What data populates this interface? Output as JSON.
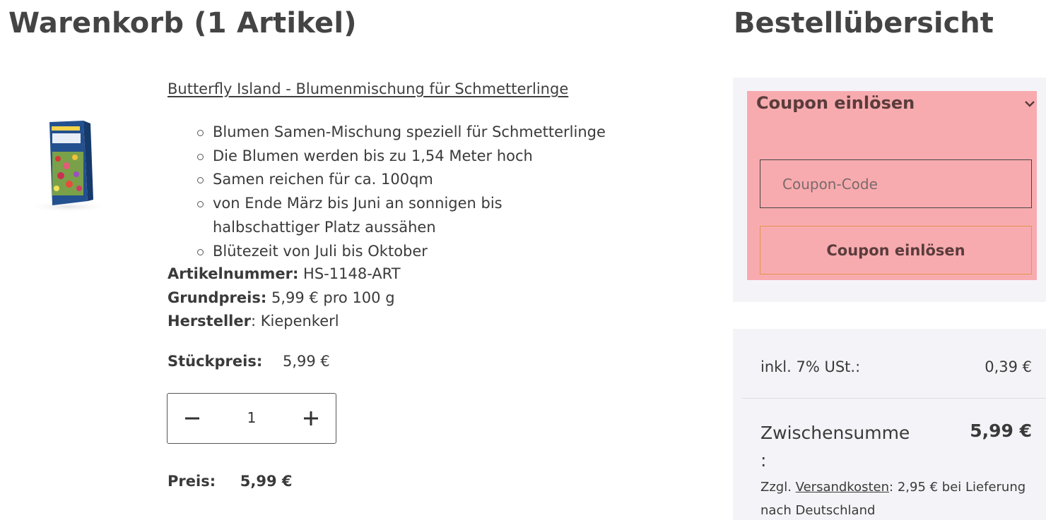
{
  "cart": {
    "title": "Warenkorb (1 Artikel)"
  },
  "product": {
    "name": "Butterfly Island - Blumenmischung für Schmetterlinge",
    "features": [
      "Blumen Samen-Mischung speziell für Schmetterlinge",
      "Die Blumen werden bis zu 1,54 Meter hoch",
      "Samen reichen für ca. 100qm",
      "von Ende März bis Juni an sonnigen bis halbschattiger Platz aussähen",
      "Blütezeit von Juli bis Oktober"
    ],
    "sku_label": "Artikelnummer:",
    "sku_value": "HS-1148-ART",
    "base_price_label": "Grundpreis:",
    "base_price_value": "5,99 € pro 100 g",
    "manufacturer_label": "Hersteller",
    "manufacturer_value": "Kiepenkerl",
    "unit_price_label": "Stückpreis:",
    "unit_price_value": "5,99 €",
    "quantity": "1",
    "price_label": "Preis:",
    "price_value": "5,99 €"
  },
  "summary": {
    "title": "Bestellübersicht",
    "coupon": {
      "heading": "Coupon einlösen",
      "input_placeholder": "Coupon-Code",
      "button_label": "Coupon einlösen"
    },
    "vat_label": "inkl. 7% USt.:",
    "vat_value": "0,39 €",
    "subtotal_label": "Zwischensumme :",
    "subtotal_value": "5,99 €",
    "shipping_prefix": "Zzgl.",
    "shipping_link": "Versandkosten",
    "shipping_suffix": ": 2,95 € bei Lieferung nach Deutschland"
  },
  "colors": {
    "coupon_highlight": "#f8abaf",
    "panel_background": "#f4f4f8",
    "button_border": "#e1964a"
  }
}
